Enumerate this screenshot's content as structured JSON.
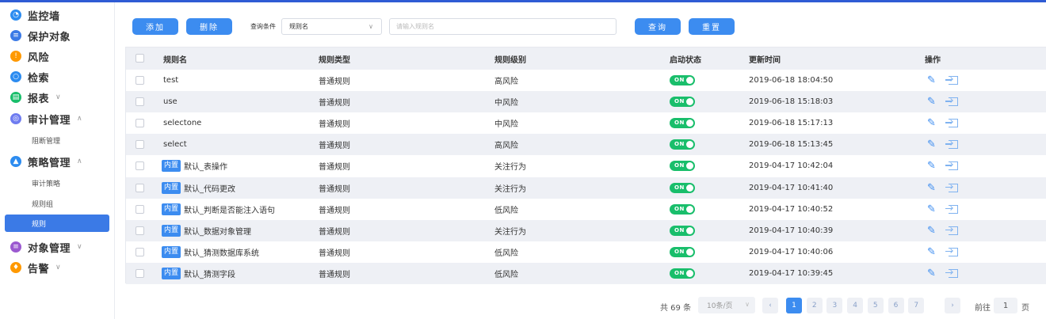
{
  "sidebar": {
    "items": [
      {
        "label": "监控墙",
        "icon": "monitor-icon",
        "color": "#2d8cf0"
      },
      {
        "label": "保护对象",
        "icon": "shield-icon",
        "color": "#3b7ae6"
      },
      {
        "label": "风险",
        "icon": "alert-icon",
        "color": "#ff9900"
      },
      {
        "label": "检索",
        "icon": "search-icon",
        "color": "#2d8cf0"
      },
      {
        "label": "报表",
        "icon": "report-icon",
        "color": "#19be6b",
        "chevron": "∨"
      },
      {
        "label": "审计管理",
        "icon": "audit-icon",
        "color": "#6f7cf0",
        "chevron": "∧"
      },
      {
        "label": "策略管理",
        "icon": "policy-icon",
        "color": "#2d8cf0",
        "chevron": "∧"
      },
      {
        "label": "对象管理",
        "icon": "object-icon",
        "color": "#9b59d0",
        "chevron": "∨"
      },
      {
        "label": "告警",
        "icon": "bell-icon",
        "color": "#ff9900",
        "chevron": "∨"
      }
    ],
    "audit_sub": [
      "阻断管理"
    ],
    "policy_sub": [
      "审计策略",
      "规则组",
      "规则"
    ]
  },
  "toolbar": {
    "add_label": "添加",
    "delete_label": "删除",
    "condition_label": "查询条件",
    "condition_value": "规则名",
    "search_placeholder": "请输入规则名",
    "query_label": "查询",
    "reset_label": "重置"
  },
  "table": {
    "columns": [
      "规则名",
      "规则类型",
      "规则级别",
      "启动状态",
      "更新时间",
      "操作"
    ],
    "builtin_tag": "内置",
    "toggle_on": "ON",
    "rows": [
      {
        "name": "test",
        "builtin": false,
        "type": "普通规则",
        "level": "高风险",
        "time": "2019-06-18 18:04:50"
      },
      {
        "name": "use",
        "builtin": false,
        "type": "普通规则",
        "level": "中风险",
        "time": "2019-06-18 15:18:03"
      },
      {
        "name": "selectone",
        "builtin": false,
        "type": "普通规则",
        "level": "中风险",
        "time": "2019-06-18 15:17:13"
      },
      {
        "name": "select",
        "builtin": false,
        "type": "普通规则",
        "level": "高风险",
        "time": "2019-06-18 15:13:45"
      },
      {
        "name": "默认_表操作",
        "builtin": true,
        "type": "普通规则",
        "level": "关注行为",
        "time": "2019-04-17 10:42:04"
      },
      {
        "name": "默认_代码更改",
        "builtin": true,
        "type": "普通规则",
        "level": "关注行为",
        "time": "2019-04-17 10:41:40"
      },
      {
        "name": "默认_判断是否能注入语句",
        "builtin": true,
        "type": "普通规则",
        "level": "低风险",
        "time": "2019-04-17 10:40:52"
      },
      {
        "name": "默认_数据对象管理",
        "builtin": true,
        "type": "普通规则",
        "level": "关注行为",
        "time": "2019-04-17 10:40:39"
      },
      {
        "name": "默认_猜测数据库系统",
        "builtin": true,
        "type": "普通规则",
        "level": "低风险",
        "time": "2019-04-17 10:40:06"
      },
      {
        "name": "默认_猜测字段",
        "builtin": true,
        "type": "普通规则",
        "level": "低风险",
        "time": "2019-04-17 10:39:45"
      }
    ]
  },
  "pagination": {
    "total": "共 69 条",
    "page_size": "10条/页",
    "prev": "‹",
    "next": "›",
    "pages": [
      "1",
      "2",
      "3",
      "4",
      "5",
      "6",
      "7"
    ],
    "current": "1",
    "goto_label": "前往",
    "goto_value": "1",
    "goto_suffix": "页"
  }
}
